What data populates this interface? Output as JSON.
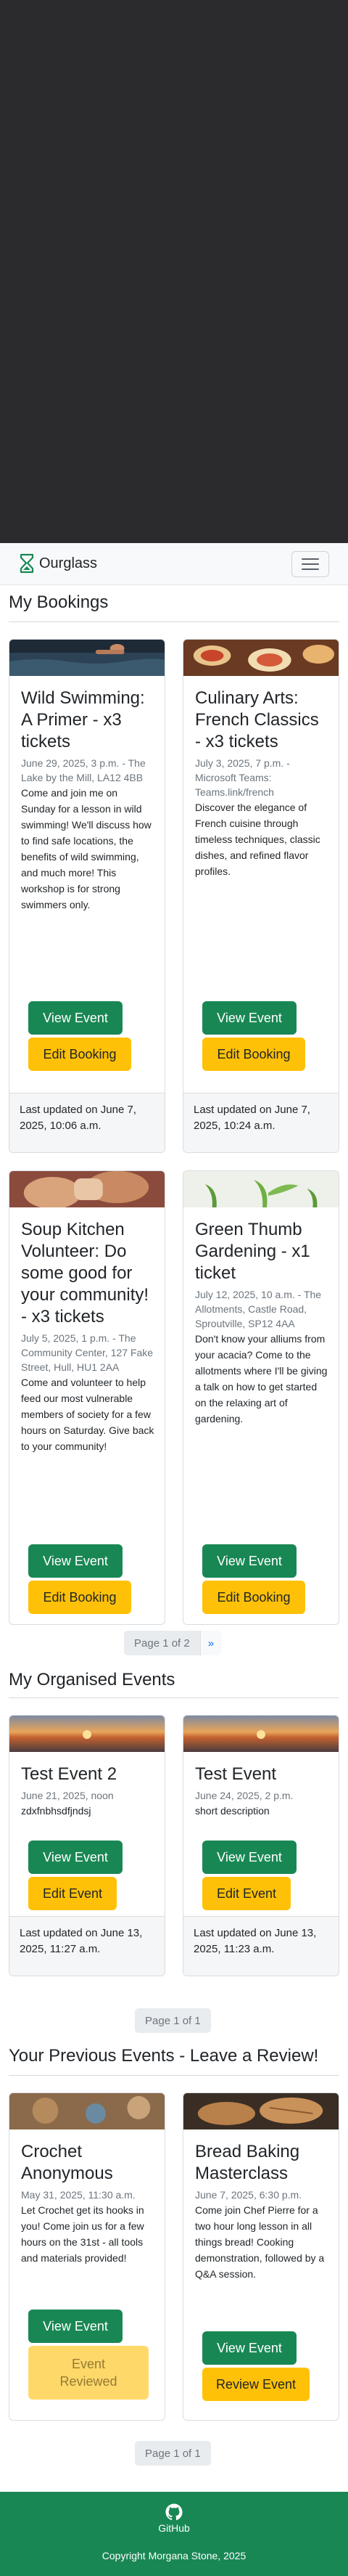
{
  "brand": {
    "name": "Ourglass"
  },
  "sections": {
    "bookings": "My Bookings",
    "organised": "My Organised Events",
    "previous": "Your Previous Events - Leave a Review!"
  },
  "bookings": [
    {
      "title": "Wild Swimming: A Primer - x3 tickets",
      "meta": "June 29, 2025, 3 p.m. - The Lake by the Mill, LA12 4BB",
      "desc": "Come and join me on Sunday for a lesson in wild swimming! We'll discuss how to find safe locations, the benefits of wild swimming, and much more! This workshop is for strong swimmers only.",
      "view": "View Event",
      "edit": "Edit Booking",
      "footer": "Last updated on June 7, 2025, 10:06 a.m."
    },
    {
      "title": "Culinary Arts: French Classics - x3 tickets",
      "meta": "July 3, 2025, 7 p.m. - Microsoft Teams: Teams.link/french",
      "desc": "Discover the elegance of French cuisine through timeless techniques, classic dishes, and refined flavor profiles.",
      "view": "View Event",
      "edit": "Edit Booking",
      "footer": "Last updated on June 7, 2025, 10:24 a.m."
    },
    {
      "title": "Soup Kitchen Volunteer: Do some good for your community! - x3 tickets",
      "meta": "July 5, 2025, 1 p.m. - The Community Center, 127 Fake Street, Hull, HU1 2AA",
      "desc": "Come and volunteer to help feed our most vulnerable members of society for a few hours on Saturday. Give back to your community!",
      "view": "View Event",
      "edit": "Edit Booking"
    },
    {
      "title": "Green Thumb Gardening - x1 ticket",
      "meta": "July 12, 2025, 10 a.m. - The Allotments, Castle Road, Sproutville, SP12 4AA",
      "desc": "Don't know your alliums from your acacia? Come to the allotments where I'll be giving a talk on how to get started on the relaxing art of gardening.",
      "view": "View Event",
      "edit": "Edit Booking"
    }
  ],
  "bookings_pager": {
    "label": "Page 1 of 2",
    "next": "»"
  },
  "organised": [
    {
      "title": "Test Event 2",
      "meta": "June 21, 2025, noon",
      "desc": "zdxfnbhsdfjndsj",
      "view": "View Event",
      "edit": "Edit Event",
      "footer": "Last updated on June 13, 2025, 11:27 a.m."
    },
    {
      "title": "Test Event",
      "meta": "June 24, 2025, 2 p.m.",
      "desc": "short description",
      "view": "View Event",
      "edit": "Edit Event",
      "footer": "Last updated on June 13, 2025, 11:23 a.m."
    }
  ],
  "organised_pager": {
    "label": "Page 1 of 1"
  },
  "previous": [
    {
      "title": "Crochet Anonymous",
      "meta": "May 31, 2025, 11:30 a.m.",
      "desc": "Let Crochet get its hooks in you! Come join us for a few hours on the 31st - all tools and materials provided!",
      "view": "View Event",
      "review": "Event Reviewed"
    },
    {
      "title": "Bread Baking Masterclass",
      "meta": "June 7, 2025, 6:30 p.m.",
      "desc": "Come join Chef Pierre for a two hour long lesson in all things bread! Cooking demonstration, followed by a Q&A session.",
      "view": "View Event",
      "review": "Review Event"
    }
  ],
  "previous_pager": {
    "label": "Page 1 of 1"
  },
  "footer": {
    "github": "GitHub",
    "copyright": "Copyright Morgana Stone, 2025"
  },
  "colors": {
    "primary_green": "#198754",
    "warning_yellow": "#ffc107",
    "hero_dark": "#2b2b2d"
  },
  "icons": {
    "brand": "hourglass-icon",
    "menu": "hamburger-menu-icon",
    "github": "github-icon"
  }
}
